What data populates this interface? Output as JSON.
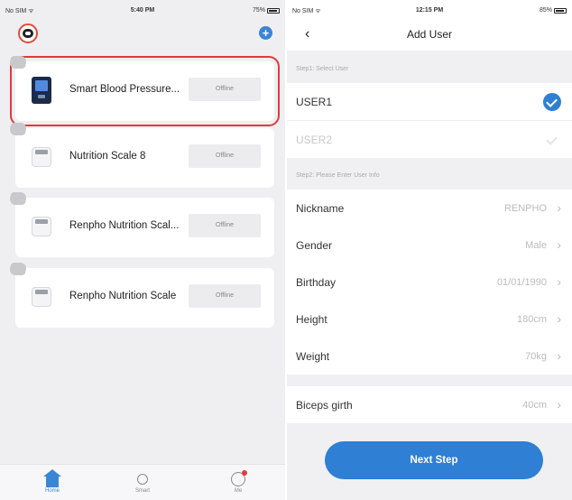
{
  "left": {
    "status_bar": {
      "carrier": "No SIM ᯤ",
      "time": "5:40 PM",
      "battery": "75%"
    },
    "devices": [
      {
        "name": "Smart Blood Pressure...",
        "status": "Offline",
        "type": "blood-pressure"
      },
      {
        "name": "Nutrition Scale 8",
        "status": "Offline",
        "type": "scale"
      },
      {
        "name": "Renpho Nutrition Scal...",
        "status": "Offline",
        "type": "scale"
      },
      {
        "name": "Renpho Nutrition Scale",
        "status": "Offline",
        "type": "scale"
      }
    ],
    "tabs": [
      {
        "label": "Home",
        "icon": "home-icon",
        "active": true
      },
      {
        "label": "Smart",
        "icon": "smart-icon",
        "active": false
      },
      {
        "label": "Me",
        "icon": "me-icon",
        "active": false
      }
    ]
  },
  "right": {
    "status_bar": {
      "carrier": "No SIM ᯤ",
      "time": "12:15 PM",
      "battery": "85%"
    },
    "title": "Add User",
    "step1_header": "Step1: Select User",
    "users": [
      {
        "label": "USER1",
        "selected": true
      },
      {
        "label": "USER2",
        "selected": false
      }
    ],
    "step2_header": "Step2: Please Enter User Info",
    "fields": [
      {
        "label": "Nickname",
        "value": "RENPHO"
      },
      {
        "label": "Gender",
        "value": "Male"
      },
      {
        "label": "Birthday",
        "value": "01/01/1990"
      },
      {
        "label": "Height",
        "value": "180cm"
      },
      {
        "label": "Weight",
        "value": "70kg"
      },
      {
        "label": "Biceps girth",
        "value": "40cm"
      }
    ],
    "next_button": "Next Step"
  },
  "colors": {
    "accent": "#2f7fd4",
    "highlight": "#e23a3a"
  }
}
